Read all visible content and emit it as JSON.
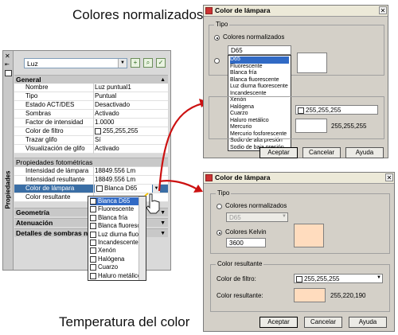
{
  "captions": {
    "top": "Colores normalizados",
    "bottom": "Temperatura del color"
  },
  "palette": {
    "title": "Propiedades",
    "object_type": "Luz",
    "groups": {
      "general": "General",
      "photometric": "Propiedades fotométricas",
      "geometry": "Geometría",
      "attenuation": "Atenuación",
      "shadow_details": "Detalles de sombras n"
    },
    "general_rows": [
      {
        "key": "Nombre",
        "value": "Luz puntual1"
      },
      {
        "key": "Tipo",
        "value": "Puntual"
      },
      {
        "key": "Estado ACT/DES",
        "value": "Desactivado"
      },
      {
        "key": "Sombras",
        "value": "Activado"
      },
      {
        "key": "Factor de intensidad",
        "value": "1.0000"
      },
      {
        "key": "Color de filtro",
        "value": "255,255,255"
      },
      {
        "key": "Trazar glifo",
        "value": "Sí"
      },
      {
        "key": "Visualización de glifo",
        "value": "Activado"
      }
    ],
    "photometric_rows": [
      {
        "key": "Intensidad de lámpara",
        "value": "18849.556 Lm"
      },
      {
        "key": "Intensidad resultante",
        "value": "18849.556 Lm"
      },
      {
        "key": "Color de lámpara",
        "value": "Blanca D65"
      },
      {
        "key": "Color resultante",
        "value": ""
      }
    ],
    "lamp_options": [
      "Blanca D65",
      "Fluorescente",
      "Blanca fría",
      "Blanca fluoresc...",
      "Luz diurna fluor...",
      "Incandescente",
      "Xenón",
      "Halógena",
      "Cuarzo",
      "Haluro metálico"
    ]
  },
  "dialog_top": {
    "title": "Color de lámpara",
    "group_tipo": "Tipo",
    "radio_std": "Colores normalizados",
    "selected_std": "D65",
    "std_options": [
      "D65",
      "Fluorescente",
      "Blanca fría",
      "Blanca fluorescente",
      "Luz diurna fluorescente",
      "Incandescente",
      "Xenón",
      "Halógena",
      "Cuarzo",
      "Haluro metálico",
      "Mercurio",
      "Mercurio fosforescente",
      "Sodio de alta presión",
      "Sodio de baja presión"
    ],
    "filter_value": "255,255,255",
    "result_value": "255,255,255",
    "buttons": {
      "ok": "Aceptar",
      "cancel": "Cancelar",
      "help": "Ayuda"
    }
  },
  "dialog_bottom": {
    "title": "Color de lámpara",
    "group_tipo": "Tipo",
    "radio_std": "Colores normalizados",
    "std_value": "D65",
    "radio_kelvin": "Colores Kelvin",
    "kelvin_value": "3600",
    "group_result": "Color resultante",
    "filter_label": "Color de filtro:",
    "filter_value": "255,255,255",
    "result_label": "Color resultante:",
    "result_value": "255,220,190",
    "buttons": {
      "ok": "Aceptar",
      "cancel": "Cancelar",
      "help": "Ayuda"
    }
  },
  "colors": {
    "kelvin_swatch": "#ffdcbe",
    "arrow": "#cc1111"
  }
}
